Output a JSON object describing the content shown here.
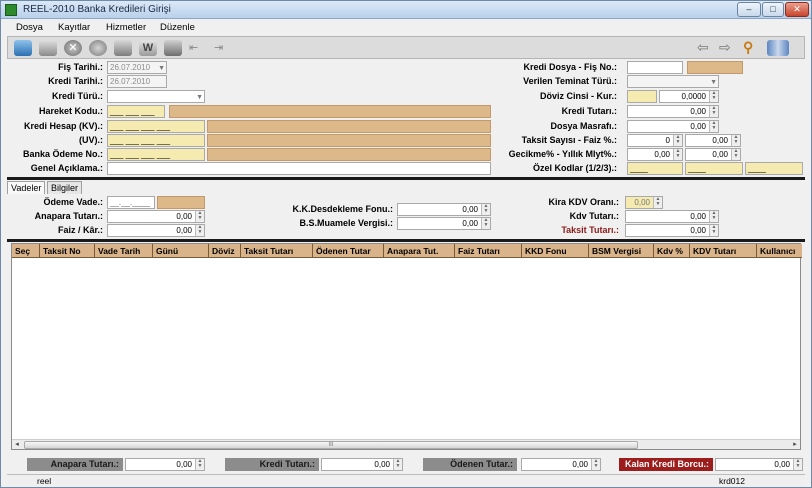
{
  "window": {
    "title": "REEL-2010 Banka Kredileri Girişi",
    "minimize": "–",
    "maximize": "□",
    "close": "✕"
  },
  "menu": [
    "Dosya",
    "Kayıtlar",
    "Hizmetler",
    "Düzenle"
  ],
  "form": {
    "fis_tarihi_label": "Fiş Tarihi.:",
    "fis_tarihi": "26.07.2010",
    "kredi_tarihi_label": "Kredi Tarihi.:",
    "kredi_tarihi": "26.07.2010",
    "kredi_turu_label": "Kredi Türü.:",
    "kredi_turu": "",
    "hareket_kodu_label": "Hareket Kodu.:",
    "hareket_kodu": "___ ___ ___",
    "kredi_hesap_label": "Kredi Hesap (KV).:",
    "kredi_hesap": "___ ___ ___ ___",
    "uv_label": "(UV).:",
    "uv": "___ ___ ___ ___",
    "banka_odeme_label": "Banka Ödeme No.:",
    "banka_odeme": "___ ___ ___ ___",
    "genel_aciklama_label": "Genel Açıklama.:",
    "genel_aciklama": "",
    "kredi_dosya_label": "Kredi Dosya - Fiş No.:",
    "teminat_label": "Verilen Teminat Türü.:",
    "doviz_label": "Döviz Cinsi - Kur.:",
    "kur": "0,0000",
    "kredi_tutari_label": "Kredi Tutarı.:",
    "kredi_tutari": "0,00",
    "dosya_masrafi_label": "Dosya Masrafı.:",
    "dosya_masrafi": "0,00",
    "taksit_label": "Taksit Sayısı - Faiz %.:",
    "taksit_sayisi": "0",
    "faiz": "0,00",
    "gecikme_label": "Gecikme% - Yıllık Mlyt%.:",
    "gecikme": "0,00",
    "yillik": "0,00",
    "ozel_kodlar_label": "Özel Kodlar (1/2/3).:",
    "ozel1": "____",
    "ozel2": "____",
    "ozel3": "____"
  },
  "tabs": [
    "Vadeler",
    "Bilgiler"
  ],
  "vadeler": {
    "odeme_vade_label": "Ödeme Vade.:",
    "odeme_vade": "__.__.____",
    "anapara_label": "Anapara Tutarı.:",
    "anapara": "0,00",
    "faiz_kar_label": "Faiz / Kâr.:",
    "faiz_kar": "0,00",
    "kkd_label": "K.K.Desdekleme Fonu.:",
    "kkd": "0,00",
    "bsmv_label": "B.S.Muamele Vergisi.:",
    "bsmv": "0,00",
    "kira_kdv_label": "Kira KDV Oranı.:",
    "kira_kdv": "0,00",
    "kdv_tutari_label": "Kdv Tutarı.:",
    "kdv_tutari": "0,00",
    "taksit_tutari_label": "Taksit Tutarı.:",
    "taksit_tutari": "0,00"
  },
  "grid": {
    "columns": [
      "Seç",
      "Taksit No",
      "Vade Tarih",
      "Günü",
      "Döviz",
      "Taksit Tutarı",
      "Ödenen Tutar",
      "Anapara Tut.",
      "Faiz Tutarı",
      "KKD Fonu",
      "BSM Vergisi",
      "Kdv %",
      "KDV Tutarı",
      "Kullanıcı"
    ],
    "scroll_grip": "III"
  },
  "footer": {
    "anapara_label": "Anapara Tutarı.:",
    "anapara": "0,00",
    "kredi_label": "Kredi Tutarı.:",
    "kredi": "0,00",
    "odenen_label": "Ödenen Tutar.:",
    "odenen": "0,00",
    "kalan_label": "Kalan Kredi Borcu.:",
    "kalan": "0,00"
  },
  "status": {
    "left": "reel",
    "right": "krd012"
  },
  "colors": {
    "tan": "#ddb98a",
    "yellow": "#f5eab0",
    "dark_red": "#9d1d1d",
    "gray_label": "#8c8c8c"
  }
}
